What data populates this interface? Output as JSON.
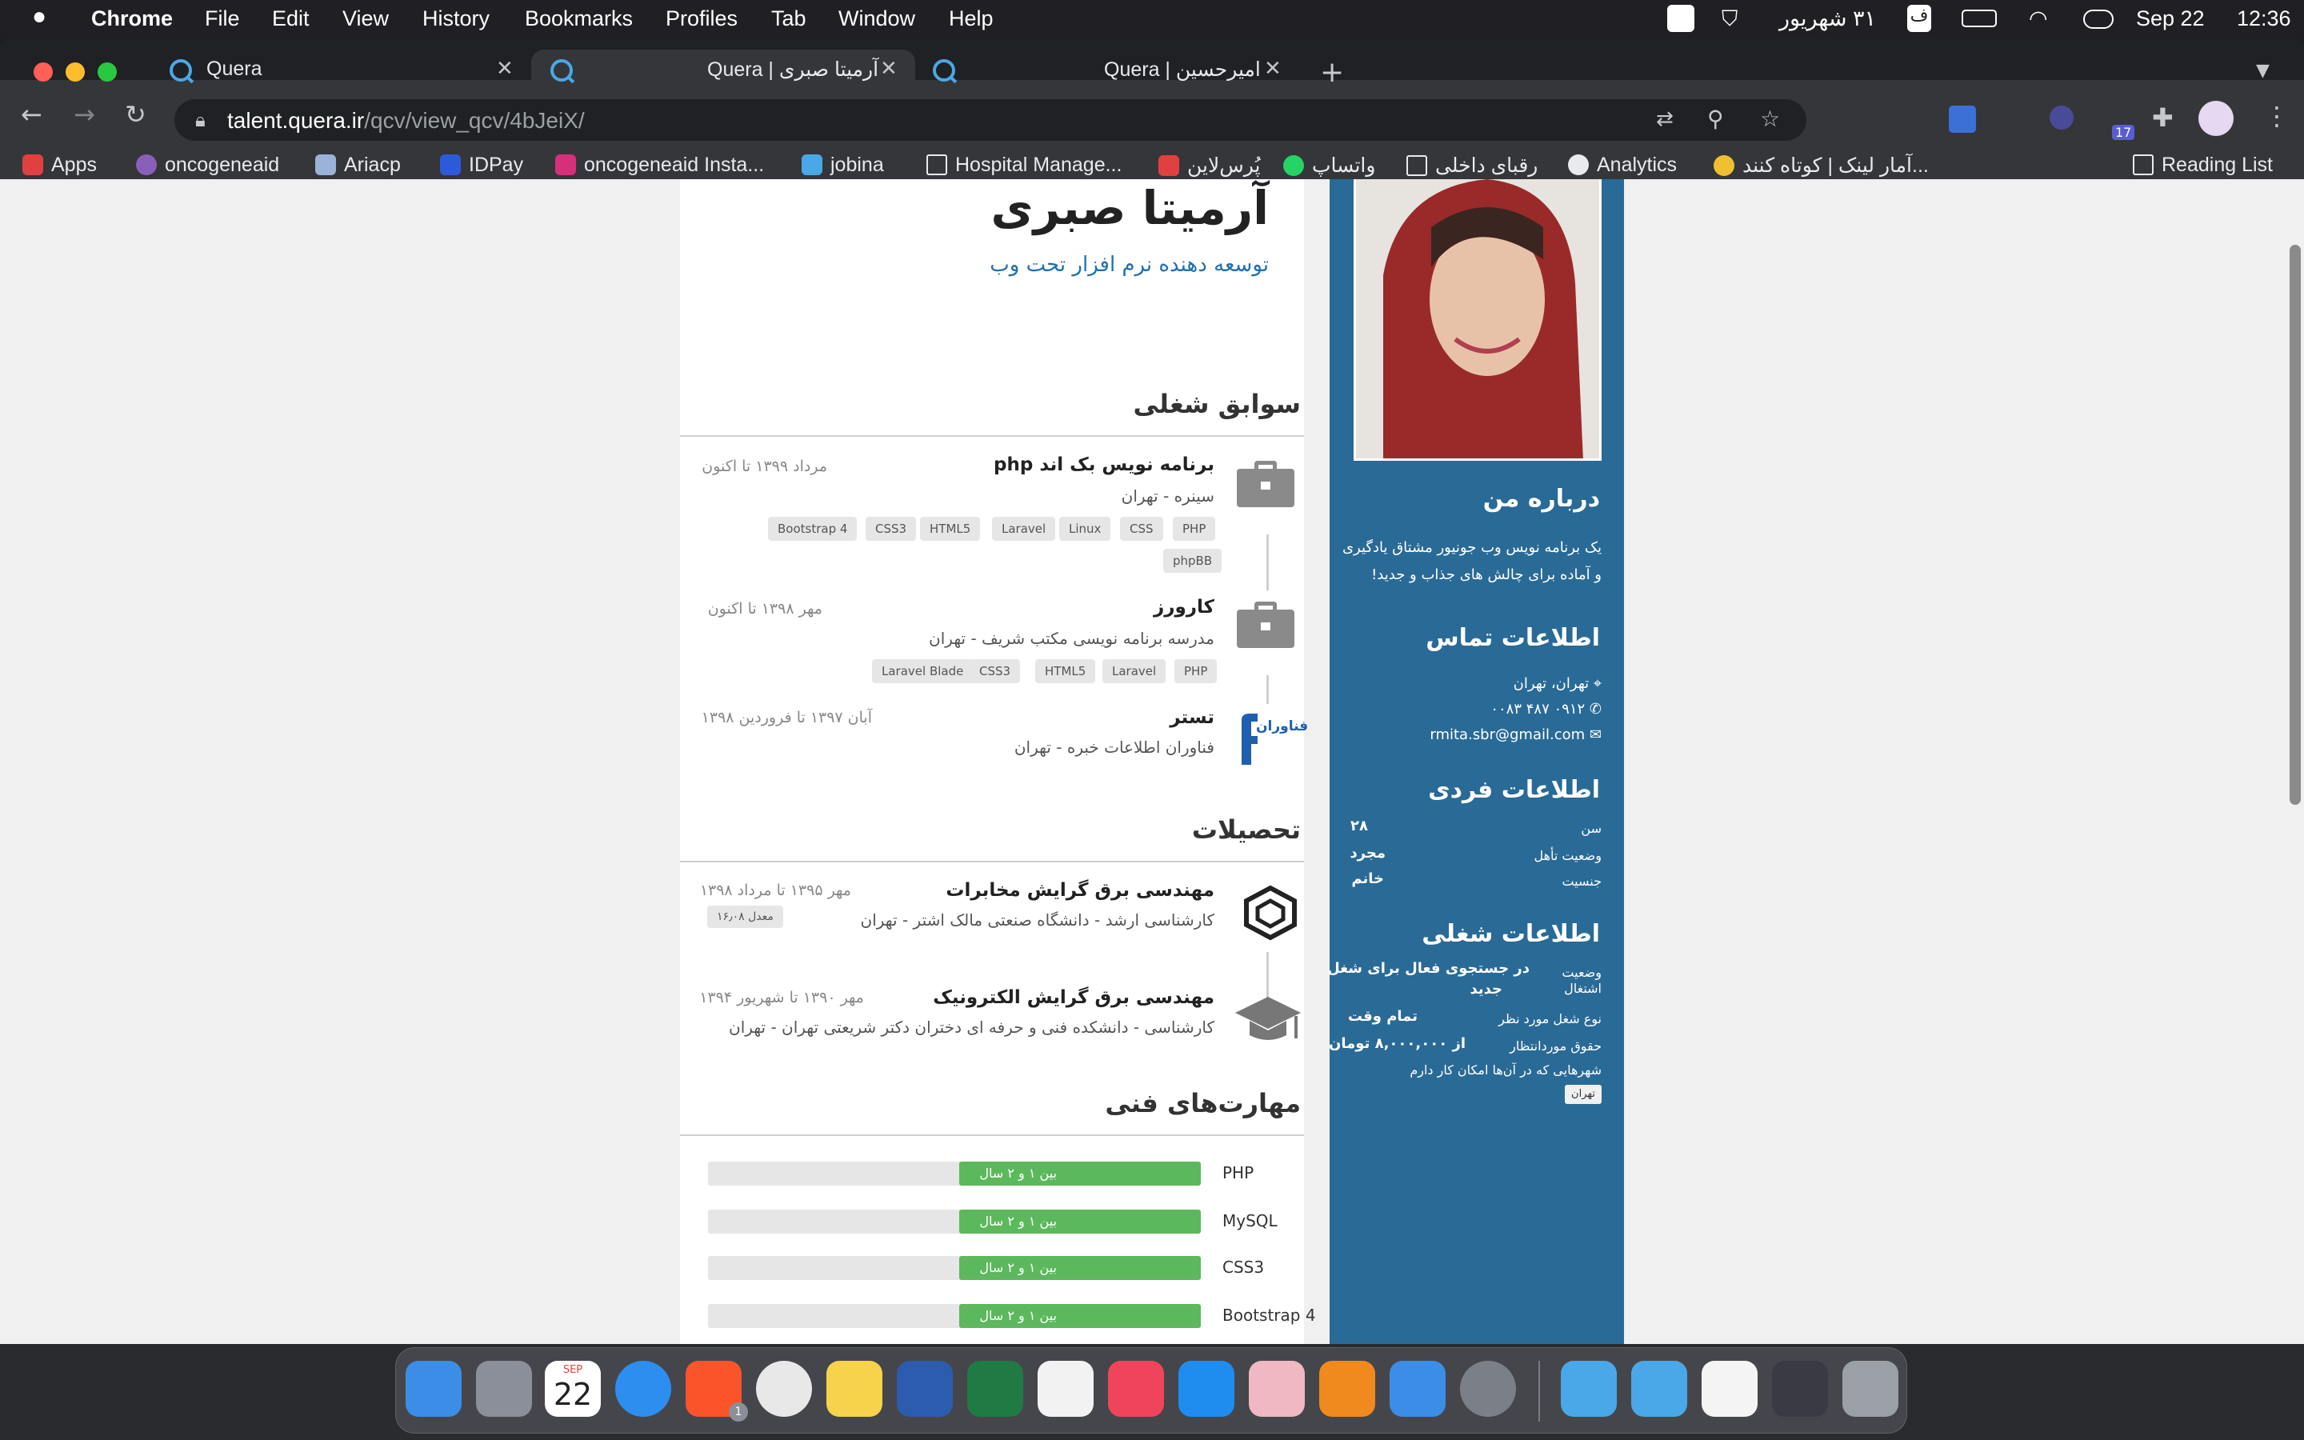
{
  "menubar": {
    "apple": "",
    "app": "Chrome",
    "items": [
      "File",
      "Edit",
      "View",
      "History",
      "Bookmarks",
      "Profiles",
      "Tab",
      "Window",
      "Help"
    ],
    "status_date_persian": "۳۱ شهریور",
    "input_lang": "ف",
    "date": "Sep 22",
    "time": "12:36"
  },
  "tabs": [
    {
      "label": "Quera",
      "active": false
    },
    {
      "label": "Quera | آرمیتا صبری",
      "active": true
    },
    {
      "label": "Quera | امیرحسین",
      "active": false
    }
  ],
  "toolbar": {
    "url_host": "talent.quera.ir",
    "url_path": "/qcv/view_qcv/4bJeiX/",
    "extensions_badge": "17"
  },
  "bookmarks": {
    "apps": "Apps",
    "items": [
      "oncogeneaid",
      "Ariacp",
      "IDPay",
      "oncogeneaid Insta...",
      "jobina",
      "Hospital Manage...",
      "پُرس‌لاین",
      "واتساپ",
      "رقبای داخلی",
      "Analytics",
      "آمار لینک | کوتاه کنند..."
    ],
    "reading_list": "Reading List"
  },
  "profile": {
    "name": "آرمیتا صبری",
    "role": "توسعه دهنده نرم افزار تحت وب"
  },
  "work": {
    "title": "سوابق شغلی",
    "jobs": [
      {
        "title": "برنامه نویس بک اند php",
        "company": "سینره - تهران",
        "date": "مرداد ۱۳۹۹ تا اکنون",
        "tags": [
          "PHP",
          "CSS",
          "Linux",
          "Laravel",
          "HTML5",
          "CSS3",
          "Bootstrap 4",
          "phpBB"
        ]
      },
      {
        "title": "کارورز",
        "company": "مدرسه برنامه نویسی مکتب شریف - تهران",
        "date": "مهر ۱۳۹۸ تا اکنون",
        "tags": [
          "PHP",
          "Laravel",
          "HTML5",
          "CSS3",
          "Laravel Blade"
        ]
      },
      {
        "title": "تستر",
        "company": "فناوران اطلاعات خبره - تهران",
        "date": "آبان ۱۳۹۷ تا فروردین ۱۳۹۸",
        "logo_text": "فناوران"
      }
    ]
  },
  "education": {
    "title": "تحصیلات",
    "items": [
      {
        "title": "مهندسی برق گرایش مخابرات",
        "school": "کارشناسی ارشد - دانشگاه صنعتی مالک اشتر - تهران",
        "date": "مهر ۱۳۹۵ تا مرداد ۱۳۹۸",
        "gpa": "معدل ۱۶٫۰۸"
      },
      {
        "title": "مهندسی برق گرایش الکترونیک",
        "school": "کارشناسی - دانشکده فنی و حرفه ای دختران دکتر شریعتی تهران - تهران",
        "date": "مهر ۱۳۹۰ تا شهریور ۱۳۹۴"
      }
    ]
  },
  "skills": {
    "title": "مهارت‌های فنی",
    "items": [
      {
        "name": "PHP",
        "label": "بین ۱ و ۲ سال",
        "level": 0.49
      },
      {
        "name": "MySQL",
        "label": "بین ۱ و ۲ سال",
        "level": 0.49
      },
      {
        "name": "CSS3",
        "label": "بین ۱ و ۲ سال",
        "level": 0.49
      },
      {
        "name": "Bootstrap 4",
        "label": "بین ۱ و ۲ سال",
        "level": 0.49
      }
    ]
  },
  "sidebar": {
    "about_title": "درباره من",
    "about_line1": "یک برنامه نویس وب جونیور مشتاق یادگیری",
    "about_line2": "و آماده برای چالش های جذاب و جدید!",
    "contact_title": "اطلاعات تماس",
    "location": "تهران، تهران",
    "phone": "۰۹۱۲ ۴۸۷ ۰۰۸۳",
    "email": "rmita.sbr@gmail.com",
    "personal_title": "اطلاعات فردی",
    "age_label": "سن",
    "age_value": "۲۸",
    "marital_label": "وضعیت تأهل",
    "marital_value": "مجرد",
    "gender_label": "جنسیت",
    "gender_value": "خانم",
    "job_title": "اطلاعات شغلی",
    "status_label1": "وضعیت",
    "status_label2": "اشتغال",
    "status_value1": "در جستجوی فعال برای شغل",
    "status_value2": "جدید",
    "jobtype_label": "نوع شغل مورد نظر",
    "jobtype_value": "تمام وقت",
    "salary_label": "حقوق موردانتظار",
    "salary_value": "از ۸,۰۰۰,۰۰۰ تومان",
    "cities_label": "شهرهایی که در آن‌ها امکان کار دارم",
    "city_tag": "تهران"
  },
  "dock": {
    "calendar_month": "SEP",
    "calendar_day": "22",
    "brave_badge": "1"
  },
  "colors": {
    "sidebar": "#2a6a96",
    "accent_link": "#1f6fb0",
    "skill_bar": "#5cb85c"
  }
}
